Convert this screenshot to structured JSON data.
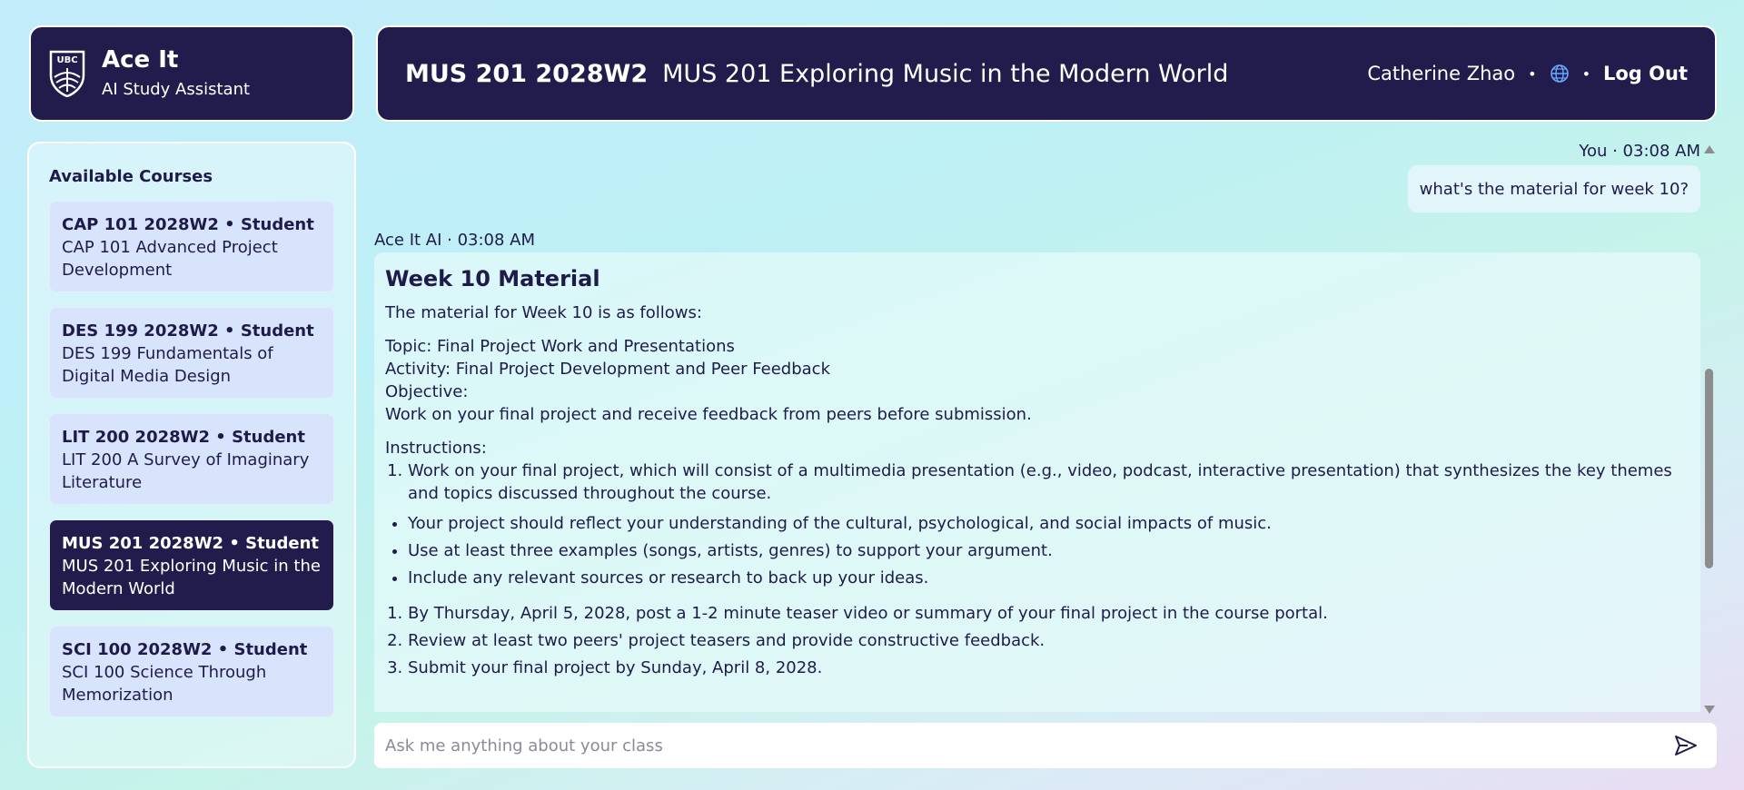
{
  "brand": {
    "title": "Ace It",
    "subtitle": "AI Study Assistant",
    "logo_icon": "ubc-shield-logo"
  },
  "header": {
    "course_code": "MUS 201 2028W2",
    "course_name": "MUS 201 Exploring Music in the Modern World",
    "user_name": "Catherine Zhao",
    "separator": "•",
    "language_icon": "globe-icon",
    "logout_label": "Log Out"
  },
  "sidebar": {
    "title": "Available Courses",
    "courses": [
      {
        "head": "CAP 101 2028W2 • Student",
        "name": "CAP 101 Advanced Project Development"
      },
      {
        "head": "DES 199 2028W2 • Student",
        "name": "DES 199 Fundamentals of Digital Media Design"
      },
      {
        "head": "LIT 200 2028W2 • Student",
        "name": "LIT 200 A Survey of Imaginary Literature"
      },
      {
        "head": "MUS 201 2028W2 • Student",
        "name": "MUS 201 Exploring Music in the Modern World",
        "active": true
      },
      {
        "head": "SCI 100 2028W2 • Student",
        "name": "SCI 100 Science Through Memorization"
      }
    ]
  },
  "chat": {
    "user_meta": "You · 03:08 AM",
    "user_message": "what's the material for week 10?",
    "ai_meta": "Ace It AI · 03:08 AM",
    "ai": {
      "heading": "Week 10 Material",
      "intro": "The material for Week 10 is as follows:",
      "topic": "Topic: Final Project Work and Presentations",
      "activity": "Activity: Final Project Development and Peer Feedback",
      "objective_label": "Objective:",
      "objective": "Work on your final project and receive feedback from peers before submission.",
      "instructions_label": "Instructions:",
      "instruction_1": "Work on your final project, which will consist of a multimedia presentation (e.g., video, podcast, interactive presentation) that synthesizes the key themes and topics discussed throughout the course.",
      "bullets": [
        "Your project should reflect your understanding of the cultural, psychological, and social impacts of music.",
        "Use at least three examples (songs, artists, genres) to support your argument.",
        "Include any relevant sources or research to back up your ideas."
      ],
      "steps": [
        "By Thursday, April 5, 2028, post a 1-2 minute teaser video or summary of your final project in the course portal.",
        "Review at least two peers' project teasers and provide constructive feedback.",
        "Submit your final project by Sunday, April 8, 2028."
      ]
    }
  },
  "input": {
    "placeholder": "Ask me anything about your class",
    "value": "",
    "send_icon": "send-icon"
  },
  "colors": {
    "navy": "#211c4b",
    "card_bg": "#d8e4fc",
    "text": "#1e1b4b"
  }
}
